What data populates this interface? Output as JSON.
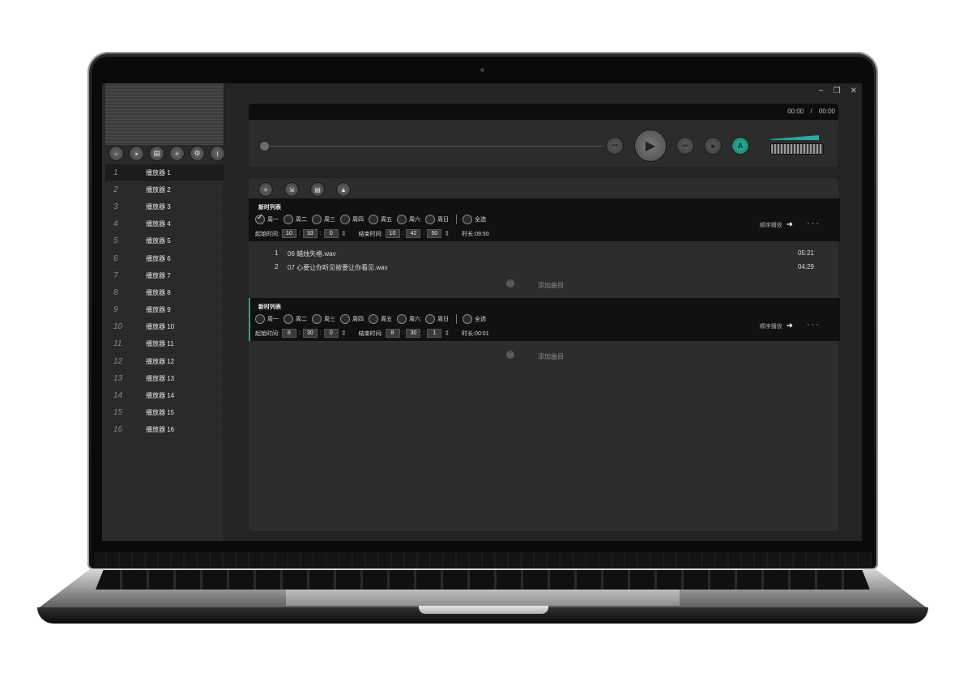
{
  "app": {
    "window_controls": [
      "−",
      "❐",
      "✕"
    ],
    "time_display": {
      "current": "00:00",
      "separator": "/",
      "total": "00:00"
    }
  },
  "sidebar": {
    "toolbar_icons": [
      "copy-icon",
      "lock-icon",
      "save-icon",
      "add-icon",
      "settings-icon",
      "info-icon"
    ],
    "players": [
      {
        "num": "1",
        "label": "播放器 1"
      },
      {
        "num": "2",
        "label": "播放器 2"
      },
      {
        "num": "3",
        "label": "播放器 3"
      },
      {
        "num": "4",
        "label": "播放器 4"
      },
      {
        "num": "5",
        "label": "播放器 5"
      },
      {
        "num": "6",
        "label": "播放器 6"
      },
      {
        "num": "7",
        "label": "播放器 7"
      },
      {
        "num": "8",
        "label": "播放器 8"
      },
      {
        "num": "9",
        "label": "播放器 9"
      },
      {
        "num": "10",
        "label": "播放器 10"
      },
      {
        "num": "11",
        "label": "播放器 11"
      },
      {
        "num": "12",
        "label": "播放器 12"
      },
      {
        "num": "13",
        "label": "播放器 13"
      },
      {
        "num": "14",
        "label": "播放器 14"
      },
      {
        "num": "15",
        "label": "播放器 15"
      },
      {
        "num": "16",
        "label": "播放器 16"
      }
    ],
    "active_index": 0
  },
  "player_controls": {
    "prev_icon": "⏮",
    "play_icon": "▶",
    "next_icon": "⏭",
    "stop_icon": "■",
    "auto_label": "A",
    "accent_color": "#1fa38a"
  },
  "schedule_toolbar_icons": [
    "add-icon",
    "import-icon",
    "save-icon",
    "clear-icon"
  ],
  "blocks": [
    {
      "title": "新时列表",
      "days": [
        "周一",
        "周二",
        "周三",
        "周四",
        "周五",
        "周六",
        "周日"
      ],
      "all_label": "全选",
      "checked_days": [
        0
      ],
      "start_label": "起始时间:",
      "start": {
        "h": "10",
        "m": "33",
        "s": "0"
      },
      "end_label": "结束时间:",
      "end": {
        "h": "10",
        "m": "42",
        "s": "50"
      },
      "duration": "时长:09:50",
      "order_label": "顺序播放",
      "tracks": [
        {
          "num": "1",
          "name": "06 蜡烛失格.wav",
          "duration": "05:21"
        },
        {
          "num": "2",
          "name": "07 心要让你听见被要让你看见.wav",
          "duration": "04:29"
        }
      ],
      "add_label": "添加曲目"
    },
    {
      "title": "新时列表",
      "days": [
        "周一",
        "周二",
        "周三",
        "周四",
        "周五",
        "周六",
        "周日"
      ],
      "all_label": "全选",
      "checked_days": [],
      "start_label": "起始时间:",
      "start": {
        "h": "8",
        "m": "30",
        "s": "0"
      },
      "end_label": "结束时间:",
      "end": {
        "h": "8",
        "m": "30",
        "s": "1"
      },
      "duration": "时长:00:01",
      "order_label": "顺序播放",
      "tracks": [],
      "add_label": "添加曲目"
    }
  ]
}
